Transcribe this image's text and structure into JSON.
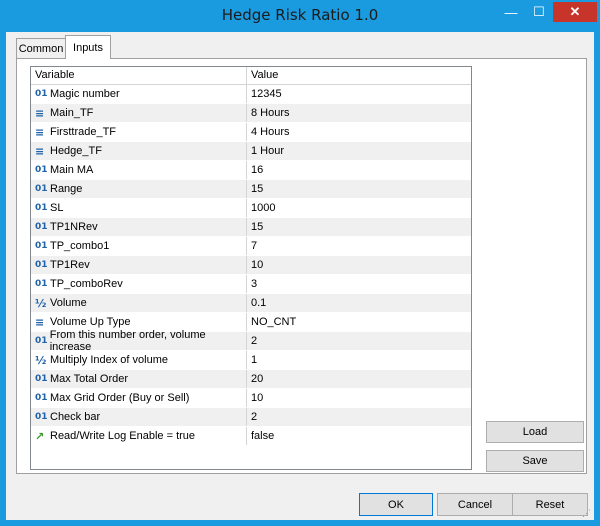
{
  "window": {
    "title": "Hedge Risk Ratio 1.0",
    "min_icon": "—",
    "max_icon": "☐",
    "close_icon": "✕"
  },
  "tabs": [
    {
      "label": "Common"
    },
    {
      "label": "Inputs"
    }
  ],
  "grid": {
    "headers": [
      "Variable",
      "Value"
    ],
    "rows": [
      {
        "icon": "01",
        "variable": "Magic number",
        "value": "12345"
      },
      {
        "icon": "≡",
        "variable": "Main_TF",
        "value": "8 Hours"
      },
      {
        "icon": "≡",
        "variable": "Firsttrade_TF",
        "value": "4 Hours"
      },
      {
        "icon": "≡",
        "variable": "Hedge_TF",
        "value": "1 Hour"
      },
      {
        "icon": "01",
        "variable": "Main MA",
        "value": "16"
      },
      {
        "icon": "01",
        "variable": "Range",
        "value": "15"
      },
      {
        "icon": "01",
        "variable": "SL",
        "value": "1000"
      },
      {
        "icon": "01",
        "variable": "TP1NRev",
        "value": "15"
      },
      {
        "icon": "01",
        "variable": "TP_combo1",
        "value": "7"
      },
      {
        "icon": "01",
        "variable": "TP1Rev",
        "value": "10"
      },
      {
        "icon": "01",
        "variable": "TP_comboRev",
        "value": "3"
      },
      {
        "icon": "½",
        "variable": "Volume",
        "value": "0.1"
      },
      {
        "icon": "≡",
        "variable": "Volume Up Type",
        "value": "NO_CNT"
      },
      {
        "icon": "01",
        "variable": "From this number order, volume increase",
        "value": "2"
      },
      {
        "icon": "½",
        "variable": "Multiply Index of volume",
        "value": "1"
      },
      {
        "icon": "01",
        "variable": "Max Total Order",
        "value": "20"
      },
      {
        "icon": "01",
        "variable": "Max Grid Order (Buy or Sell)",
        "value": "10"
      },
      {
        "icon": "01",
        "variable": "Check bar",
        "value": "2"
      },
      {
        "icon": "↗",
        "variable": "Read/Write Log Enable = true",
        "value": "false"
      }
    ]
  },
  "side_buttons": {
    "load": "Load",
    "save": "Save"
  },
  "footer_buttons": {
    "ok": "OK",
    "cancel": "Cancel",
    "reset": "Reset"
  }
}
